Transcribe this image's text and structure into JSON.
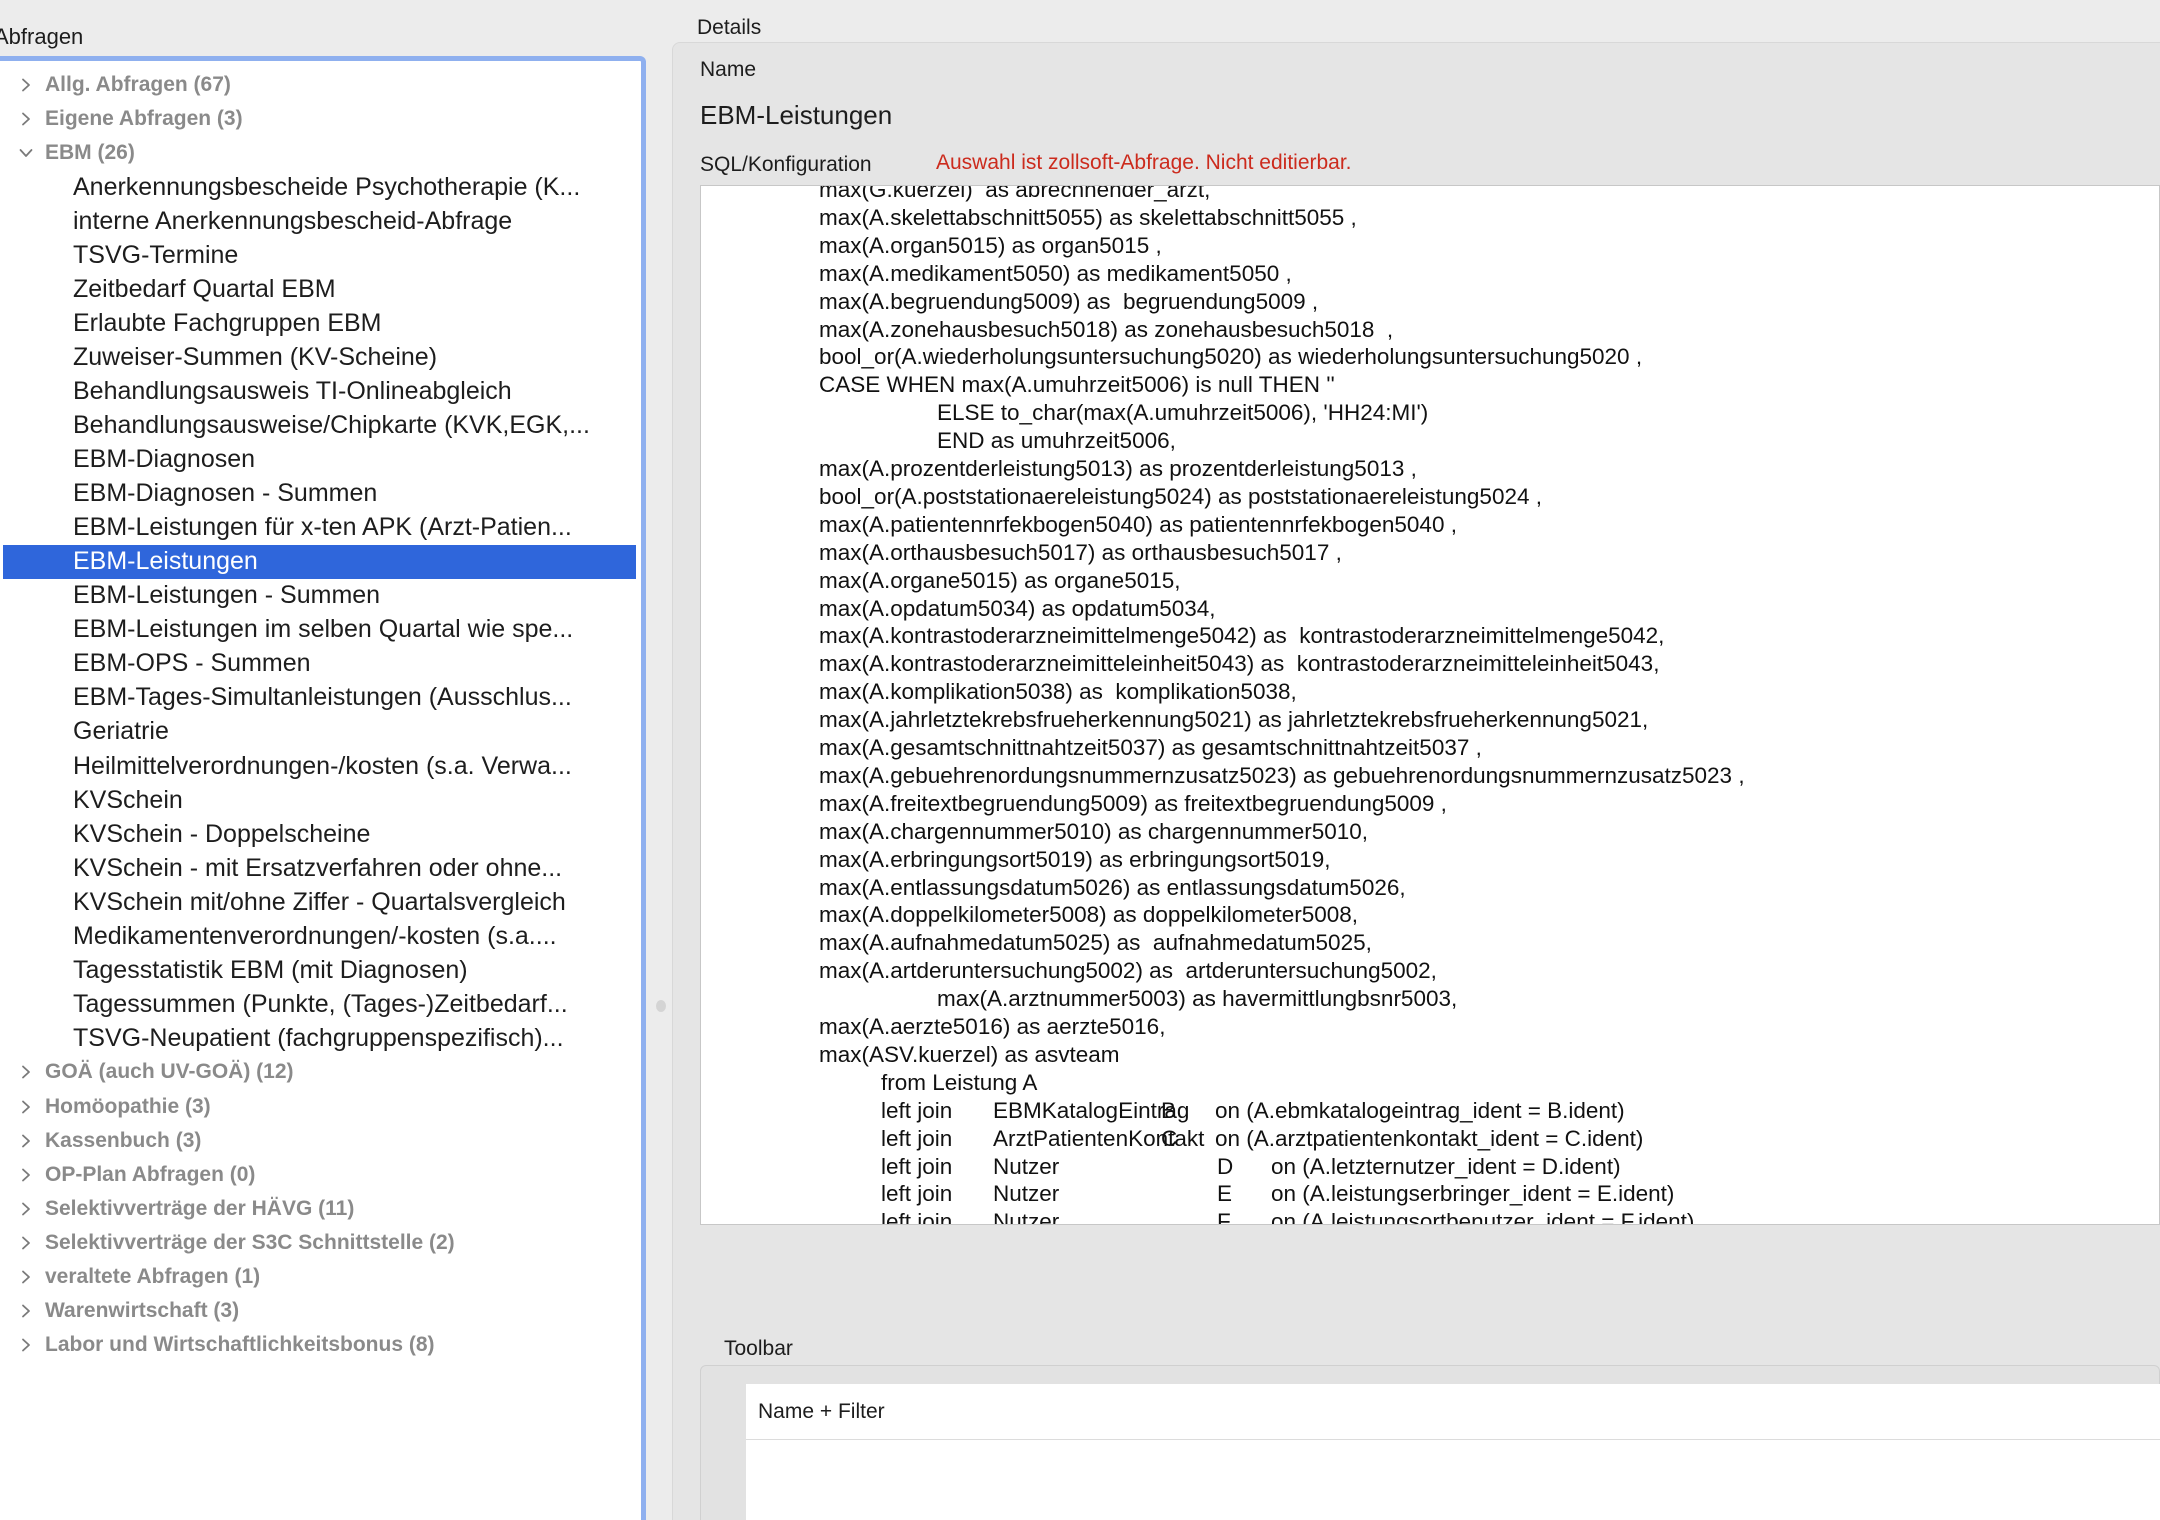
{
  "left": {
    "title": "Abfragen",
    "tree": [
      {
        "type": "group",
        "label": "Allg. Abfragen (67)",
        "expanded": false
      },
      {
        "type": "group",
        "label": "Eigene Abfragen (3)",
        "expanded": false
      },
      {
        "type": "group",
        "label": "EBM (26)",
        "expanded": true
      },
      {
        "type": "child",
        "label": "Anerkennungsbescheide Psychotherapie (K..."
      },
      {
        "type": "child",
        "label": "interne Anerkennungsbescheid-Abfrage"
      },
      {
        "type": "child",
        "label": "TSVG-Termine"
      },
      {
        "type": "child",
        "label": "Zeitbedarf Quartal EBM"
      },
      {
        "type": "child",
        "label": "Erlaubte Fachgruppen EBM"
      },
      {
        "type": "child",
        "label": "Zuweiser-Summen (KV-Scheine)"
      },
      {
        "type": "child",
        "label": "Behandlungsausweis TI-Onlineabgleich"
      },
      {
        "type": "child",
        "label": "Behandlungsausweise/Chipkarte (KVK,EGK,..."
      },
      {
        "type": "child",
        "label": "EBM-Diagnosen"
      },
      {
        "type": "child",
        "label": "EBM-Diagnosen - Summen"
      },
      {
        "type": "child",
        "label": "EBM-Leistungen für x-ten APK (Arzt-Patien..."
      },
      {
        "type": "child",
        "label": "EBM-Leistungen",
        "selected": true
      },
      {
        "type": "child",
        "label": "EBM-Leistungen - Summen"
      },
      {
        "type": "child",
        "label": "EBM-Leistungen im selben Quartal wie spe..."
      },
      {
        "type": "child",
        "label": "EBM-OPS - Summen"
      },
      {
        "type": "child",
        "label": "EBM-Tages-Simultanleistungen (Ausschlus..."
      },
      {
        "type": "child",
        "label": "Geriatrie"
      },
      {
        "type": "child",
        "label": "Heilmittelverordnungen-/kosten (s.a. Verwa..."
      },
      {
        "type": "child",
        "label": "KVSchein"
      },
      {
        "type": "child",
        "label": "KVSchein - Doppelscheine"
      },
      {
        "type": "child",
        "label": "KVSchein - mit Ersatzverfahren oder ohne..."
      },
      {
        "type": "child",
        "label": "KVSchein mit/ohne Ziffer - Quartalsvergleich"
      },
      {
        "type": "child",
        "label": "Medikamentenverordnungen/-kosten (s.a...."
      },
      {
        "type": "child",
        "label": "Tagesstatistik EBM (mit Diagnosen)"
      },
      {
        "type": "child",
        "label": "Tagessummen (Punkte, (Tages-)Zeitbedarf..."
      },
      {
        "type": "child",
        "label": "TSVG-Neupatient (fachgruppenspezifisch)..."
      },
      {
        "type": "group",
        "label": "GOÄ (auch UV-GOÄ) (12)",
        "expanded": false
      },
      {
        "type": "group",
        "label": "Homöopathie (3)",
        "expanded": false
      },
      {
        "type": "group",
        "label": "Kassenbuch (3)",
        "expanded": false
      },
      {
        "type": "group",
        "label": "OP-Plan Abfragen (0)",
        "expanded": false
      },
      {
        "type": "group",
        "label": "Selektivverträge der HÄVG (11)",
        "expanded": false
      },
      {
        "type": "group",
        "label": "Selektivverträge der S3C Schnittstelle (2)",
        "expanded": false
      },
      {
        "type": "group",
        "label": "veraltete Abfragen (1)",
        "expanded": false
      },
      {
        "type": "group",
        "label": "Warenwirtschaft (3)",
        "expanded": false
      },
      {
        "type": "group",
        "label": "Labor und Wirtschaftlichkeitsbonus (8)",
        "expanded": false
      }
    ]
  },
  "details": {
    "title": "Details",
    "name_label": "Name",
    "name_value": "EBM-Leistungen",
    "sql_label": "SQL/Konfiguration",
    "sql_warning": "Auswahl ist zollsoft-Abfrage. Nicht editierbar.",
    "sql_lines": [
      {
        "indent": 1,
        "text": "max(G.kuerzel)  as abrechnender_arzt,"
      },
      {
        "indent": 1,
        "text": "max(A.skelettabschnitt5055) as skelettabschnitt5055 ,"
      },
      {
        "indent": 1,
        "text": "max(A.organ5015) as organ5015 ,"
      },
      {
        "indent": 1,
        "text": "max(A.medikament5050) as medikament5050 ,"
      },
      {
        "indent": 1,
        "text": "max(A.begruendung5009) as  begruendung5009 ,"
      },
      {
        "indent": 1,
        "text": "max(A.zonehausbesuch5018) as zonehausbesuch5018  ,"
      },
      {
        "indent": 1,
        "text": "bool_or(A.wiederholungsuntersuchung5020) as wiederholungsuntersuchung5020 ,"
      },
      {
        "indent": 1,
        "text": "CASE WHEN max(A.umuhrzeit5006) is null THEN ''"
      },
      {
        "indent": 3,
        "text": "ELSE to_char(max(A.umuhrzeit5006), 'HH24:MI')"
      },
      {
        "indent": 3,
        "text": "END as umuhrzeit5006,"
      },
      {
        "indent": 1,
        "text": "max(A.prozentderleistung5013) as prozentderleistung5013 ,"
      },
      {
        "indent": 1,
        "text": "bool_or(A.poststationaereleistung5024) as poststationaereleistung5024 ,"
      },
      {
        "indent": 1,
        "text": "max(A.patientennrfekbogen5040) as patientennrfekbogen5040 ,"
      },
      {
        "indent": 1,
        "text": "max(A.orthausbesuch5017) as orthausbesuch5017 ,"
      },
      {
        "indent": 1,
        "text": "max(A.organe5015) as organe5015,"
      },
      {
        "indent": 1,
        "text": "max(A.opdatum5034) as opdatum5034,"
      },
      {
        "indent": 1,
        "text": "max(A.kontrastoderarzneimittelmenge5042) as  kontrastoderarzneimittelmenge5042,"
      },
      {
        "indent": 1,
        "text": "max(A.kontrastoderarzneimitteleinheit5043) as  kontrastoderarzneimitteleinheit5043,"
      },
      {
        "indent": 1,
        "text": "max(A.komplikation5038) as  komplikation5038,"
      },
      {
        "indent": 1,
        "text": "max(A.jahrletztekrebsfrueherkennung5021) as jahrletztekrebsfrueherkennung5021,"
      },
      {
        "indent": 1,
        "text": "max(A.gesamtschnittnahtzeit5037) as gesamtschnittnahtzeit5037 ,"
      },
      {
        "indent": 1,
        "text": "max(A.gebuehrenordungsnummernzusatz5023) as gebuehrenordungsnummernzusatz5023 ,"
      },
      {
        "indent": 1,
        "text": "max(A.freitextbegruendung5009) as freitextbegruendung5009 ,"
      },
      {
        "indent": 1,
        "text": "max(A.chargennummer5010) as chargennummer5010,"
      },
      {
        "indent": 1,
        "text": "max(A.erbringungsort5019) as erbringungsort5019,"
      },
      {
        "indent": 1,
        "text": "max(A.entlassungsdatum5026) as entlassungsdatum5026,"
      },
      {
        "indent": 1,
        "text": "max(A.doppelkilometer5008) as doppelkilometer5008,"
      },
      {
        "indent": 1,
        "text": "max(A.aufnahmedatum5025) as  aufnahmedatum5025,"
      },
      {
        "indent": 1,
        "text": "max(A.artderuntersuchung5002) as  artderuntersuchung5002,"
      },
      {
        "indent": 3,
        "text": "max(A.arztnummer5003) as havermittlungbsnr5003,"
      },
      {
        "indent": 1,
        "text": "max(A.aerzte5016) as aerzte5016,"
      },
      {
        "indent": 1,
        "text": "max(ASV.kuerzel) as asvteam"
      },
      {
        "indent": 2,
        "text": "from Leistung A"
      },
      {
        "indent": 2,
        "cols": [
          "left join",
          "EBMKatalogEintrag",
          "B",
          "on (A.ebmkatalogeintrag_ident = B.ident)"
        ]
      },
      {
        "indent": 2,
        "cols": [
          "left join",
          "ArztPatientenKontakt",
          "C",
          "on (A.arztpatientenkontakt_ident = C.ident)"
        ]
      },
      {
        "indent": 2,
        "cols": [
          "left join",
          "Nutzer",
          "D",
          "on (A.letzternutzer_ident = D.ident)"
        ]
      },
      {
        "indent": 2,
        "cols": [
          "left join",
          "Nutzer",
          "E",
          "on (A.leistungserbringer_ident = E.ident)"
        ]
      },
      {
        "indent": 2,
        "cols": [
          "left join",
          "Nutzer",
          "F",
          "on (A.leistungsortbenutzer_ident = F.ident)"
        ]
      }
    ]
  },
  "toolbar": {
    "title": "Toolbar",
    "column_header": "Name + Filter"
  },
  "colors": {
    "selection": "#2f66db",
    "focus_ring": "#8fb0ef",
    "warning": "#cc2b1d"
  },
  "icons": {
    "collapsed": "chevron-right-icon",
    "expanded": "chevron-down-icon"
  }
}
